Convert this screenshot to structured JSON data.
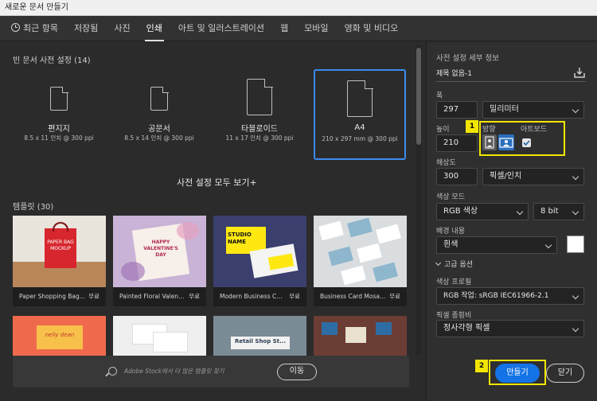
{
  "window": {
    "title": "새로운 문서 만들기"
  },
  "tabs": [
    {
      "label": "최근 항목"
    },
    {
      "label": "저장됨"
    },
    {
      "label": "사진"
    },
    {
      "label": "인쇄"
    },
    {
      "label": "아트 및 일러스트레이션"
    },
    {
      "label": "웹"
    },
    {
      "label": "모바일"
    },
    {
      "label": "영화 및 비디오"
    }
  ],
  "active_tab": "인쇄",
  "presets_section": {
    "title": "빈 문서 사전 설정",
    "count": "(14)"
  },
  "presets": [
    {
      "name": "편지지",
      "size": "8.5 x 11 인치 @ 300 ppi"
    },
    {
      "name": "공문서",
      "size": "8.5 x 14 인치 @ 300 ppi"
    },
    {
      "name": "타블로이드",
      "size": "11 x 17 인치 @ 300 ppi"
    },
    {
      "name": "A4",
      "size": "210 x 297 mm @ 300 ppi"
    }
  ],
  "selected_preset": "A4",
  "view_all_label": "사전 설정 모두 보기+",
  "templates_section": {
    "title": "템플릿",
    "count": "(30)"
  },
  "templates": [
    {
      "name": "Paper Shopping Bag...",
      "price": "무료",
      "thumb_text": "PAPER BAG\nMOCKUP"
    },
    {
      "name": "Painted Floral Valenti...",
      "price": "무료",
      "thumb_text": "HAPPY\nVALENTINE'S\nDAY"
    },
    {
      "name": "Modern Business Car...",
      "price": "무료",
      "thumb_text": "STUDIO\nNAME"
    },
    {
      "name": "Business Card Mosai...",
      "price": "무료",
      "thumb_text": ""
    },
    {
      "thumb_text": "nelly dean"
    },
    {
      "thumb_text": ""
    },
    {
      "thumb_text": "Retail Shop St..."
    },
    {
      "thumb_text": ""
    }
  ],
  "stock": {
    "placeholder": "Adobe Stock에서 더 많은 템플릿 찾기",
    "go_label": "이동"
  },
  "details": {
    "header": "사전 설정 세부 정보",
    "doc_name": "제목 없음-1",
    "width_label": "폭",
    "width_value": "297",
    "width_unit": "밀리미터",
    "height_label": "높이",
    "height_value": "210",
    "orientation_label": "방향",
    "artboard_label": "아트보드",
    "resolution_label": "해상도",
    "resolution_value": "300",
    "resolution_unit": "픽셀/인치",
    "color_mode_label": "색상 모드",
    "color_mode_value": "RGB 색상",
    "bit_depth_value": "8 bit",
    "background_label": "배경 내용",
    "background_value": "흰색",
    "advanced_label": "고급 옵션",
    "color_profile_label": "색상 프로필",
    "color_profile_value": "RGB 작업: sRGB IEC61966-2.1",
    "pixel_aspect_label": "픽셀 종횡비",
    "pixel_aspect_value": "정사각형 픽셀"
  },
  "annotations": {
    "badge1": "1",
    "badge2": "2"
  },
  "buttons": {
    "create": "만들기",
    "close": "닫기"
  },
  "colors": {
    "accent": "#1473e6",
    "highlight": "#f2e600",
    "selected_border": "#3c8cf0"
  }
}
